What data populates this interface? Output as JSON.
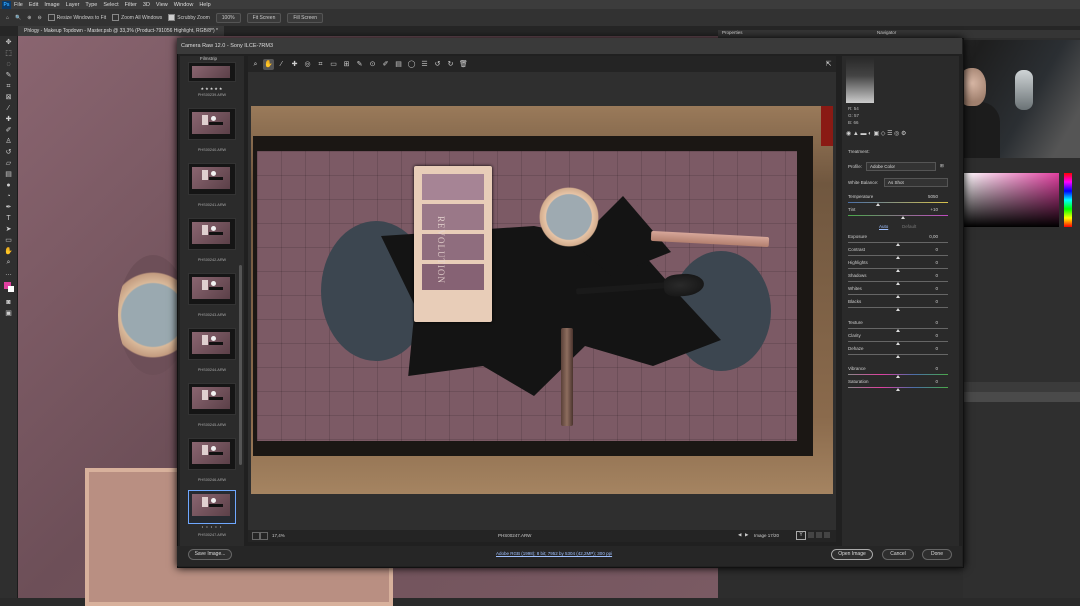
{
  "menubar": {
    "app_icon": "Ps",
    "items": [
      "File",
      "Edit",
      "Image",
      "Layer",
      "Type",
      "Select",
      "Filter",
      "3D",
      "View",
      "Window",
      "Help"
    ]
  },
  "options_bar": {
    "resize_windows": "Resize Windows to Fit",
    "zoom_all_windows": "Zoom All Windows",
    "scrubby_zoom": "Scrubby Zoom",
    "zoom_100": "100%",
    "fit_screen": "Fit Screen",
    "fill_screen": "Fill Screen"
  },
  "document_tab": "Phlogy - Makeup Topdown - Master.psb @ 33,3% (Product-791056 Highlight, RGB/8*) *",
  "panels": {
    "properties": "Properties",
    "navigator": "Navigator"
  },
  "camera_raw": {
    "title": "Camera Raw 12.0  -  Sony ILCE-7RM3",
    "filmstrip_label": "Filmstrip",
    "thumbnails": [
      {
        "label": "PHS00239.ARW",
        "stars": "★★★★★"
      },
      {
        "label": "PHS00240.ARW",
        "stars": ""
      },
      {
        "label": "PHS00241.ARW",
        "stars": ""
      },
      {
        "label": "PHS00242.ARW",
        "stars": ""
      },
      {
        "label": "PHS00243.ARW",
        "stars": ""
      },
      {
        "label": "PHS00244.ARW",
        "stars": ""
      },
      {
        "label": "PHS00245.ARW",
        "stars": ""
      },
      {
        "label": "PHS00246.ARW",
        "stars": ""
      },
      {
        "label": "PHS00247.ARW",
        "stars": "• • • • •"
      }
    ],
    "photo_text": {
      "palette_brand": "REVOLUTION"
    },
    "bottom_bar": {
      "zoom": "17,4%",
      "filename": "PHS00247.ARW",
      "image_count": "Image 17/20"
    },
    "histogram_rgb": {
      "r": "R:  54",
      "g": "G:  57",
      "b": "B:  66"
    },
    "treatment_label": "Treatment:",
    "profile_label": "Profile:",
    "profile_value": "Adobe Color",
    "white_balance_label": "White Balance:",
    "white_balance_value": "As Shot",
    "auto_label": "Auto",
    "default_label": "Default",
    "sliders": [
      {
        "name": "Temperature",
        "value": "5050",
        "level": 0.3
      },
      {
        "name": "Tint",
        "value": "+10",
        "level": 0.55
      },
      {
        "name": "Exposure",
        "value": "0,00",
        "level": 0.5
      },
      {
        "name": "Contrast",
        "value": "0",
        "level": 0.5
      },
      {
        "name": "Highlights",
        "value": "0",
        "level": 0.5
      },
      {
        "name": "Shadows",
        "value": "0",
        "level": 0.5
      },
      {
        "name": "Whites",
        "value": "0",
        "level": 0.5
      },
      {
        "name": "Blacks",
        "value": "0",
        "level": 0.5
      },
      {
        "name": "Texture",
        "value": "0",
        "level": 0.5
      },
      {
        "name": "Clarity",
        "value": "0",
        "level": 0.5
      },
      {
        "name": "Dehaze",
        "value": "0",
        "level": 0.5
      },
      {
        "name": "Vibrance",
        "value": "0",
        "level": 0.5
      },
      {
        "name": "Saturation",
        "value": "0",
        "level": 0.5
      }
    ],
    "footer": {
      "save_image": "Save Image...",
      "workflow_link": "Adobe RGB (1998); 8 bit; 7952 by 5304 (42,2MP); 300 ppi",
      "open_image": "Open Image",
      "cancel": "Cancel",
      "done": "Done"
    }
  },
  "colors": {
    "accent_selection": "#6fa8ff",
    "foreground_swatch": "#e040a0"
  }
}
